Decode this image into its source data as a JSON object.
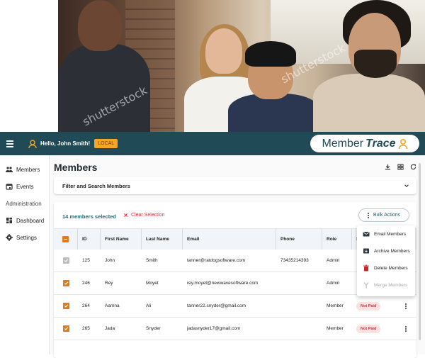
{
  "hero": {
    "watermark": "shutterstock"
  },
  "topbar": {
    "greeting": "Hello, John Smith!",
    "env_badge": "LOCAL",
    "brand_part1": "Member",
    "brand_part2": "Trace"
  },
  "sidebar": {
    "items": [
      {
        "label": "Members",
        "icon": "people-icon"
      },
      {
        "label": "Events",
        "icon": "calendar-icon"
      }
    ],
    "section": "Administration",
    "admin_items": [
      {
        "label": "Dashboard",
        "icon": "dashboard-icon"
      },
      {
        "label": "Settings",
        "icon": "gear-icon"
      }
    ]
  },
  "main": {
    "title": "Members",
    "filter_label": "Filter and Search Members",
    "selected_count": "14 members selected",
    "clear_selection": "Clear Selection",
    "bulk_actions": "Bulk Actions",
    "columns": [
      "ID",
      "First Name",
      "Last Name",
      "Email",
      "Phone",
      "Role",
      "S"
    ],
    "rows": [
      {
        "id": "125",
        "first": "John",
        "last": "Smith",
        "email": "tanner@ratdogsoftware.com",
        "phone": "73435214393",
        "role": "Admin",
        "status": "",
        "disabled": true
      },
      {
        "id": "246",
        "first": "Rey",
        "last": "Moyet",
        "email": "rey.moyet@newwavesoftware.com",
        "phone": "",
        "role": "Admin",
        "status": "",
        "disabled": false
      },
      {
        "id": "264",
        "first": "Aamna",
        "last": "Ali",
        "email": "tanner22.snyder@gmail.com",
        "phone": "",
        "role": "Member",
        "status": "Not Paid",
        "disabled": false
      },
      {
        "id": "265",
        "first": "Jada",
        "last": "Snyder",
        "email": "jadasnyder17@gmail.com",
        "phone": "",
        "role": "Member",
        "status": "Not Paid",
        "disabled": false
      }
    ]
  },
  "bulk_menu": [
    {
      "label": "Email Members",
      "icon": "email-icon",
      "enabled": true
    },
    {
      "label": "Archive Members",
      "icon": "archive-icon",
      "enabled": true
    },
    {
      "label": "Delete Members",
      "icon": "trash-icon",
      "enabled": true
    },
    {
      "label": "Merge Members",
      "icon": "merge-icon",
      "enabled": false
    }
  ],
  "colors": {
    "topbar": "#1f4a56",
    "accent": "#e07b1a",
    "badge": "#f5a623",
    "danger": "#d33333"
  }
}
